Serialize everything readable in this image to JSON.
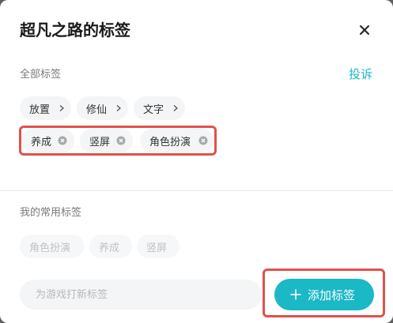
{
  "dialog": {
    "title": "超凡之路的标签",
    "close_icon": "close-icon"
  },
  "all_tags": {
    "label": "全部标签",
    "report": "投诉",
    "category_chips": [
      {
        "label": "放置",
        "icon": "chevron-right-icon"
      },
      {
        "label": "修仙",
        "icon": "chevron-right-icon"
      },
      {
        "label": "文字",
        "icon": "chevron-right-icon"
      }
    ],
    "selected_chips": [
      {
        "label": "养成",
        "icon": "remove-icon"
      },
      {
        "label": "竖屏",
        "icon": "remove-icon"
      },
      {
        "label": "角色扮演",
        "icon": "remove-icon"
      }
    ]
  },
  "common_tags": {
    "label": "我的常用标签",
    "chips": [
      "角色扮演",
      "养成",
      "竖屏"
    ]
  },
  "new_tag": {
    "placeholder": "为游戏打新标签",
    "value": ""
  },
  "add_button": {
    "label": "添加标签",
    "icon": "plus-icon"
  },
  "colors": {
    "accent": "#1bb8c6",
    "highlight": "#e0524c",
    "chip_bg": "#f3f5f6"
  }
}
